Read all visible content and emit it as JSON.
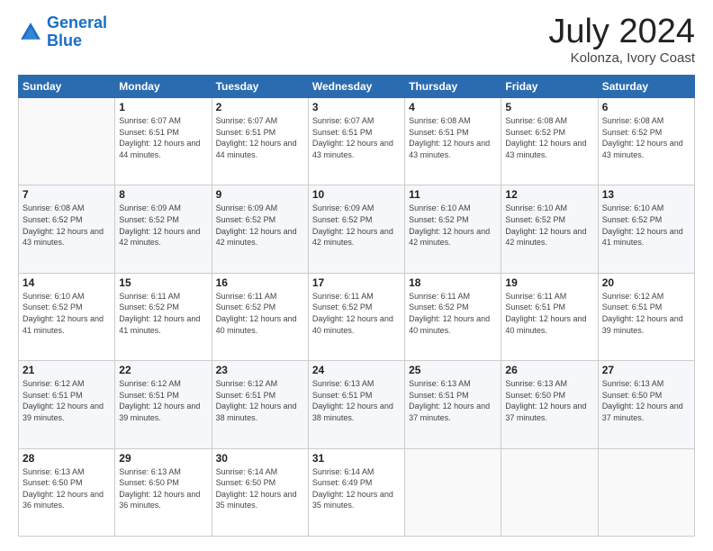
{
  "logo": {
    "line1": "General",
    "line2": "Blue"
  },
  "title": "July 2024",
  "location": "Kolonza, Ivory Coast",
  "weekdays": [
    "Sunday",
    "Monday",
    "Tuesday",
    "Wednesday",
    "Thursday",
    "Friday",
    "Saturday"
  ],
  "weeks": [
    [
      {
        "day": "",
        "sunrise": "",
        "sunset": "",
        "daylight": ""
      },
      {
        "day": "1",
        "sunrise": "Sunrise: 6:07 AM",
        "sunset": "Sunset: 6:51 PM",
        "daylight": "Daylight: 12 hours and 44 minutes."
      },
      {
        "day": "2",
        "sunrise": "Sunrise: 6:07 AM",
        "sunset": "Sunset: 6:51 PM",
        "daylight": "Daylight: 12 hours and 44 minutes."
      },
      {
        "day": "3",
        "sunrise": "Sunrise: 6:07 AM",
        "sunset": "Sunset: 6:51 PM",
        "daylight": "Daylight: 12 hours and 43 minutes."
      },
      {
        "day": "4",
        "sunrise": "Sunrise: 6:08 AM",
        "sunset": "Sunset: 6:51 PM",
        "daylight": "Daylight: 12 hours and 43 minutes."
      },
      {
        "day": "5",
        "sunrise": "Sunrise: 6:08 AM",
        "sunset": "Sunset: 6:52 PM",
        "daylight": "Daylight: 12 hours and 43 minutes."
      },
      {
        "day": "6",
        "sunrise": "Sunrise: 6:08 AM",
        "sunset": "Sunset: 6:52 PM",
        "daylight": "Daylight: 12 hours and 43 minutes."
      }
    ],
    [
      {
        "day": "7",
        "sunrise": "Sunrise: 6:08 AM",
        "sunset": "Sunset: 6:52 PM",
        "daylight": "Daylight: 12 hours and 43 minutes."
      },
      {
        "day": "8",
        "sunrise": "Sunrise: 6:09 AM",
        "sunset": "Sunset: 6:52 PM",
        "daylight": "Daylight: 12 hours and 42 minutes."
      },
      {
        "day": "9",
        "sunrise": "Sunrise: 6:09 AM",
        "sunset": "Sunset: 6:52 PM",
        "daylight": "Daylight: 12 hours and 42 minutes."
      },
      {
        "day": "10",
        "sunrise": "Sunrise: 6:09 AM",
        "sunset": "Sunset: 6:52 PM",
        "daylight": "Daylight: 12 hours and 42 minutes."
      },
      {
        "day": "11",
        "sunrise": "Sunrise: 6:10 AM",
        "sunset": "Sunset: 6:52 PM",
        "daylight": "Daylight: 12 hours and 42 minutes."
      },
      {
        "day": "12",
        "sunrise": "Sunrise: 6:10 AM",
        "sunset": "Sunset: 6:52 PM",
        "daylight": "Daylight: 12 hours and 42 minutes."
      },
      {
        "day": "13",
        "sunrise": "Sunrise: 6:10 AM",
        "sunset": "Sunset: 6:52 PM",
        "daylight": "Daylight: 12 hours and 41 minutes."
      }
    ],
    [
      {
        "day": "14",
        "sunrise": "Sunrise: 6:10 AM",
        "sunset": "Sunset: 6:52 PM",
        "daylight": "Daylight: 12 hours and 41 minutes."
      },
      {
        "day": "15",
        "sunrise": "Sunrise: 6:11 AM",
        "sunset": "Sunset: 6:52 PM",
        "daylight": "Daylight: 12 hours and 41 minutes."
      },
      {
        "day": "16",
        "sunrise": "Sunrise: 6:11 AM",
        "sunset": "Sunset: 6:52 PM",
        "daylight": "Daylight: 12 hours and 40 minutes."
      },
      {
        "day": "17",
        "sunrise": "Sunrise: 6:11 AM",
        "sunset": "Sunset: 6:52 PM",
        "daylight": "Daylight: 12 hours and 40 minutes."
      },
      {
        "day": "18",
        "sunrise": "Sunrise: 6:11 AM",
        "sunset": "Sunset: 6:52 PM",
        "daylight": "Daylight: 12 hours and 40 minutes."
      },
      {
        "day": "19",
        "sunrise": "Sunrise: 6:11 AM",
        "sunset": "Sunset: 6:51 PM",
        "daylight": "Daylight: 12 hours and 40 minutes."
      },
      {
        "day": "20",
        "sunrise": "Sunrise: 6:12 AM",
        "sunset": "Sunset: 6:51 PM",
        "daylight": "Daylight: 12 hours and 39 minutes."
      }
    ],
    [
      {
        "day": "21",
        "sunrise": "Sunrise: 6:12 AM",
        "sunset": "Sunset: 6:51 PM",
        "daylight": "Daylight: 12 hours and 39 minutes."
      },
      {
        "day": "22",
        "sunrise": "Sunrise: 6:12 AM",
        "sunset": "Sunset: 6:51 PM",
        "daylight": "Daylight: 12 hours and 39 minutes."
      },
      {
        "day": "23",
        "sunrise": "Sunrise: 6:12 AM",
        "sunset": "Sunset: 6:51 PM",
        "daylight": "Daylight: 12 hours and 38 minutes."
      },
      {
        "day": "24",
        "sunrise": "Sunrise: 6:13 AM",
        "sunset": "Sunset: 6:51 PM",
        "daylight": "Daylight: 12 hours and 38 minutes."
      },
      {
        "day": "25",
        "sunrise": "Sunrise: 6:13 AM",
        "sunset": "Sunset: 6:51 PM",
        "daylight": "Daylight: 12 hours and 37 minutes."
      },
      {
        "day": "26",
        "sunrise": "Sunrise: 6:13 AM",
        "sunset": "Sunset: 6:50 PM",
        "daylight": "Daylight: 12 hours and 37 minutes."
      },
      {
        "day": "27",
        "sunrise": "Sunrise: 6:13 AM",
        "sunset": "Sunset: 6:50 PM",
        "daylight": "Daylight: 12 hours and 37 minutes."
      }
    ],
    [
      {
        "day": "28",
        "sunrise": "Sunrise: 6:13 AM",
        "sunset": "Sunset: 6:50 PM",
        "daylight": "Daylight: 12 hours and 36 minutes."
      },
      {
        "day": "29",
        "sunrise": "Sunrise: 6:13 AM",
        "sunset": "Sunset: 6:50 PM",
        "daylight": "Daylight: 12 hours and 36 minutes."
      },
      {
        "day": "30",
        "sunrise": "Sunrise: 6:14 AM",
        "sunset": "Sunset: 6:50 PM",
        "daylight": "Daylight: 12 hours and 35 minutes."
      },
      {
        "day": "31",
        "sunrise": "Sunrise: 6:14 AM",
        "sunset": "Sunset: 6:49 PM",
        "daylight": "Daylight: 12 hours and 35 minutes."
      },
      {
        "day": "",
        "sunrise": "",
        "sunset": "",
        "daylight": ""
      },
      {
        "day": "",
        "sunrise": "",
        "sunset": "",
        "daylight": ""
      },
      {
        "day": "",
        "sunrise": "",
        "sunset": "",
        "daylight": ""
      }
    ]
  ]
}
